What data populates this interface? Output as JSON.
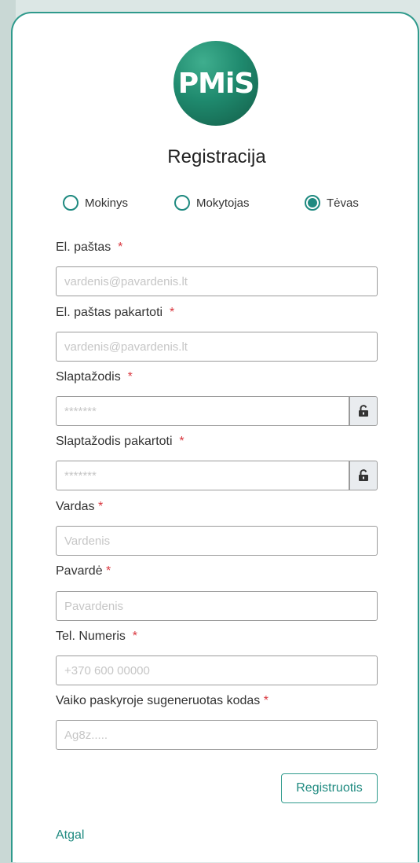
{
  "logo": {
    "text": "PMiS"
  },
  "title": "Registracija",
  "roles": [
    {
      "label": "Mokinys",
      "selected": false
    },
    {
      "label": "Mokytojas",
      "selected": false
    },
    {
      "label": "Tėvas",
      "selected": true
    }
  ],
  "required_mark": "*",
  "fields": {
    "email": {
      "label": "El. paštas",
      "placeholder": "vardenis@pavardenis.lt",
      "value": ""
    },
    "email_repeat": {
      "label": "El. paštas pakartoti",
      "placeholder": "vardenis@pavardenis.lt",
      "value": ""
    },
    "password": {
      "label": "Slaptažodis",
      "placeholder": "*******",
      "value": ""
    },
    "password_repeat": {
      "label": "Slaptažodis pakartoti",
      "placeholder": "*******",
      "value": ""
    },
    "first_name": {
      "label": "Vardas",
      "placeholder": "Vardenis",
      "value": ""
    },
    "last_name": {
      "label": "Pavardė",
      "placeholder": "Pavardenis",
      "value": ""
    },
    "phone": {
      "label": "Tel. Numeris",
      "placeholder": "+370 600 00000",
      "value": ""
    },
    "child_code": {
      "label": "Vaiko paskyroje sugeneruotas kodas",
      "placeholder": "Ag8z.....",
      "value": ""
    }
  },
  "icons": {
    "password_toggle": "unlock-icon",
    "password_repeat_toggle": "unlock-icon"
  },
  "colors": {
    "accent": "#1f8a80",
    "border": "#2f9a8c",
    "required": "#d9363e"
  },
  "buttons": {
    "submit": "Registruotis",
    "back": "Atgal"
  }
}
